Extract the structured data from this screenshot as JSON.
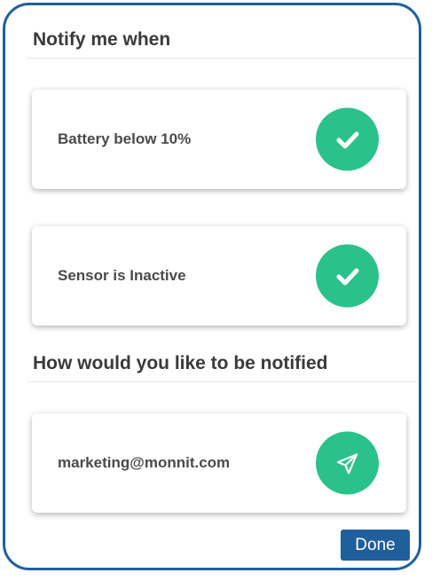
{
  "notify_section": {
    "title": "Notify me when",
    "items": [
      {
        "label": "Battery below 10%",
        "icon": "check-icon",
        "checked": true
      },
      {
        "label": "Sensor is Inactive",
        "icon": "check-icon",
        "checked": true
      }
    ]
  },
  "method_section": {
    "title": "How would you like to be notified",
    "items": [
      {
        "label": "marketing@monnit.com",
        "icon": "send-icon"
      }
    ]
  },
  "actions": {
    "done_label": "Done"
  },
  "colors": {
    "border": "#1f5f9c",
    "accent_green": "#2bc18b",
    "button_blue": "#1f5f9c",
    "title_text": "#3a3a3a",
    "card_text": "#4a4a4a"
  }
}
